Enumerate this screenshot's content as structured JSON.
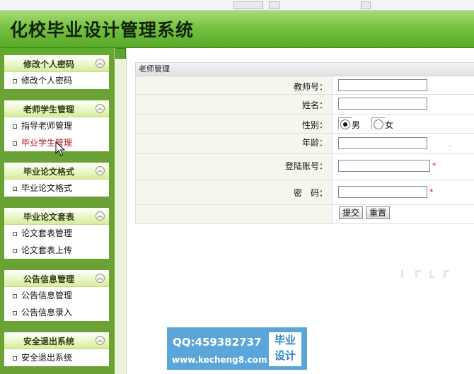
{
  "header": {
    "title": "化校毕业设计管理系统"
  },
  "sidebar": {
    "panels": [
      {
        "title": "修改个人密码",
        "items": [
          "修改个人密码"
        ]
      },
      {
        "title": "老师学生管理",
        "items": [
          "指导老师管理",
          "毕业学生管理"
        ]
      },
      {
        "title": "毕业论文格式",
        "items": [
          "毕业论文格式"
        ]
      },
      {
        "title": "毕业论文套表",
        "items": [
          "论文套表管理",
          "论文套表上传"
        ]
      },
      {
        "title": "公告信息管理",
        "items": [
          "公告信息管理",
          "公告信息录入"
        ]
      },
      {
        "title": "安全退出系统",
        "items": [
          "安全退出系统"
        ]
      }
    ],
    "collapse_glyph": "︽"
  },
  "form": {
    "title": "老师管理",
    "teacher_no_label": "教师号：",
    "name_label": "姓名：",
    "gender_label": "性别：",
    "gender_options": [
      "男",
      "女"
    ],
    "gender_selected": "男",
    "age_label": "年龄：",
    "login_label": "登陆账号：",
    "password_label": "密　码：",
    "required_mark": "*",
    "submit_label": "提交",
    "reset_label": "重置"
  },
  "watermark": {
    "qq": "QQ:459382737",
    "url": "www.kecheng8.com",
    "badge_line1": "毕业",
    "badge_line2": "设计"
  }
}
